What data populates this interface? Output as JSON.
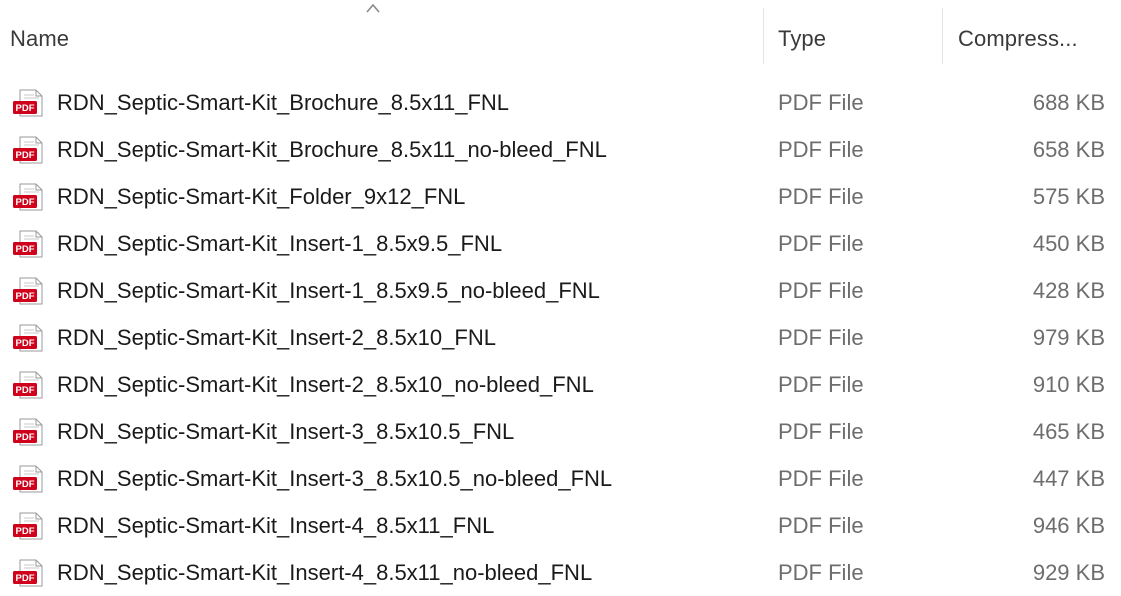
{
  "header": {
    "name_label": "Name",
    "type_label": "Type",
    "size_label": "Compress...",
    "sort_icon": "chevron-up-icon"
  },
  "files": [
    {
      "name": "RDN_Septic-Smart-Kit_Brochure_8.5x11_FNL",
      "type": "PDF File",
      "size": "688 KB",
      "icon": "pdf-icon"
    },
    {
      "name": "RDN_Septic-Smart-Kit_Brochure_8.5x11_no-bleed_FNL",
      "type": "PDF File",
      "size": "658 KB",
      "icon": "pdf-icon"
    },
    {
      "name": "RDN_Septic-Smart-Kit_Folder_9x12_FNL",
      "type": "PDF File",
      "size": "575 KB",
      "icon": "pdf-icon"
    },
    {
      "name": "RDN_Septic-Smart-Kit_Insert-1_8.5x9.5_FNL",
      "type": "PDF File",
      "size": "450 KB",
      "icon": "pdf-icon"
    },
    {
      "name": "RDN_Septic-Smart-Kit_Insert-1_8.5x9.5_no-bleed_FNL",
      "type": "PDF File",
      "size": "428 KB",
      "icon": "pdf-icon"
    },
    {
      "name": "RDN_Septic-Smart-Kit_Insert-2_8.5x10_FNL",
      "type": "PDF File",
      "size": "979 KB",
      "icon": "pdf-icon"
    },
    {
      "name": "RDN_Septic-Smart-Kit_Insert-2_8.5x10_no-bleed_FNL",
      "type": "PDF File",
      "size": "910 KB",
      "icon": "pdf-icon"
    },
    {
      "name": "RDN_Septic-Smart-Kit_Insert-3_8.5x10.5_FNL",
      "type": "PDF File",
      "size": "465 KB",
      "icon": "pdf-icon"
    },
    {
      "name": "RDN_Septic-Smart-Kit_Insert-3_8.5x10.5_no-bleed_FNL",
      "type": "PDF File",
      "size": "447 KB",
      "icon": "pdf-icon"
    },
    {
      "name": "RDN_Septic-Smart-Kit_Insert-4_8.5x11_FNL",
      "type": "PDF File",
      "size": "946 KB",
      "icon": "pdf-icon"
    },
    {
      "name": "RDN_Septic-Smart-Kit_Insert-4_8.5x11_no-bleed_FNL",
      "type": "PDF File",
      "size": "929 KB",
      "icon": "pdf-icon"
    }
  ],
  "colors": {
    "pdf_red": "#d0021b",
    "header_text": "#3a3a3a",
    "secondary_text": "#6d6d6d"
  }
}
